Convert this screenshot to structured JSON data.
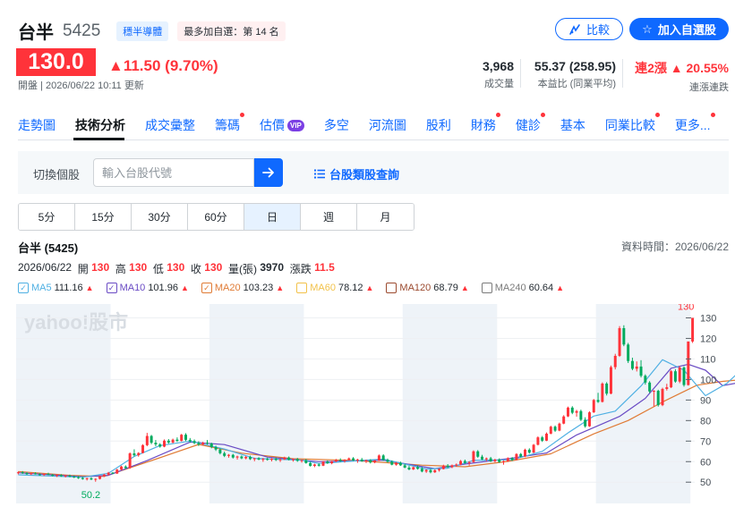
{
  "header": {
    "name": "台半",
    "code": "5425",
    "badge_sector": "穩半導體",
    "badge_rank": "最多加自選：第 14 名",
    "compare_label": "比較",
    "watchlist_label": "加入自選股"
  },
  "quote": {
    "price": "130.0",
    "change": "▲11.50 (9.70%)",
    "status_time": "開盤 | 2026/06/22 10:11 更新"
  },
  "stats": [
    {
      "value": "3,968",
      "label": "成交量"
    },
    {
      "value": "55.37 (258.95)",
      "label": "本益比 (同業平均)"
    },
    {
      "value": "連2漲 ▲ 20.55%",
      "label": "連漲連跌"
    }
  ],
  "tabs": [
    {
      "label": "走勢圖",
      "dot": false
    },
    {
      "label": "技術分析",
      "dot": false,
      "active": true
    },
    {
      "label": "成交彙整",
      "dot": false
    },
    {
      "label": "籌碼",
      "dot": true
    },
    {
      "label": "估價",
      "dot": false,
      "vip": "VIP"
    },
    {
      "label": "多空",
      "dot": false
    },
    {
      "label": "河流圖",
      "dot": false
    },
    {
      "label": "股利",
      "dot": false
    },
    {
      "label": "財務",
      "dot": true
    },
    {
      "label": "健診",
      "dot": true
    },
    {
      "label": "基本",
      "dot": false
    },
    {
      "label": "同業比較",
      "dot": true
    },
    {
      "label": "更多...",
      "dot": true
    }
  ],
  "search": {
    "label": "切換個股",
    "placeholder": "輸入台股代號",
    "category_link": "台股類股查詢"
  },
  "periods": [
    "5分",
    "15分",
    "30分",
    "60分",
    "日",
    "週",
    "月"
  ],
  "active_period": "日",
  "chart_header": {
    "title": "台半 (5425)",
    "data_time": "資料時間：2026/06/22",
    "date": "2026/06/22",
    "open_label": "開",
    "open": "130",
    "high_label": "高",
    "high": "130",
    "low_label": "低",
    "low": "130",
    "close_label": "收",
    "close": "130",
    "volume_label": "量(張)",
    "volume": "3970",
    "change_label": "漲跌",
    "change": "11.5"
  },
  "ma_legend": [
    {
      "name": "MA5",
      "value": "111.16",
      "color": "#4fb0e3"
    },
    {
      "name": "MA10",
      "value": "101.96",
      "color": "#6a4bc4"
    },
    {
      "name": "MA20",
      "value": "103.23",
      "color": "#e07b35"
    },
    {
      "name": "MA60",
      "value": "78.12",
      "color": "#f2c24a"
    },
    {
      "name": "MA120",
      "value": "68.79",
      "color": "#9b4a2f"
    },
    {
      "name": "MA240",
      "value": "60.64",
      "color": "#7a7a7a"
    }
  ],
  "colors": {
    "accent": "#0f69ff",
    "up": "#ff333a",
    "down": "#00ab5e"
  },
  "chart_data": {
    "type": "candlestick",
    "watermark": "yahoo!股市",
    "y_ticks": [
      50,
      60,
      70,
      80,
      90,
      100,
      110,
      120,
      130
    ],
    "ylim": [
      44,
      135
    ],
    "last_price_label": "130",
    "min_label": "50.2",
    "min_value": 50.2,
    "candles": [
      [
        54.5,
        55.2,
        53.8,
        54.8
      ],
      [
        54.8,
        55.4,
        54.0,
        54.4
      ],
      [
        54.4,
        54.9,
        53.6,
        53.9
      ],
      [
        53.9,
        54.6,
        53.5,
        54.3
      ],
      [
        54.3,
        54.8,
        53.7,
        53.8
      ],
      [
        53.8,
        54.3,
        53.2,
        53.5
      ],
      [
        53.5,
        54.2,
        53.0,
        54.0
      ],
      [
        54.0,
        54.6,
        53.4,
        53.6
      ],
      [
        53.6,
        54.0,
        52.8,
        53.1
      ],
      [
        53.1,
        53.8,
        52.5,
        53.4
      ],
      [
        53.4,
        53.9,
        52.6,
        52.9
      ],
      [
        52.9,
        53.5,
        52.3,
        53.2
      ],
      [
        53.2,
        53.7,
        52.4,
        52.7
      ],
      [
        52.7,
        53.3,
        52.0,
        52.4
      ],
      [
        52.4,
        53.0,
        51.6,
        52.0
      ],
      [
        52.0,
        52.6,
        51.2,
        51.5
      ],
      [
        51.5,
        52.2,
        50.8,
        51.9
      ],
      [
        51.9,
        52.4,
        51.0,
        51.3
      ],
      [
        51.3,
        51.9,
        50.2,
        51.6
      ],
      [
        51.6,
        53.2,
        51.3,
        52.9
      ],
      [
        52.9,
        54.0,
        52.5,
        53.7
      ],
      [
        53.7,
        55.0,
        53.2,
        54.6
      ],
      [
        54.6,
        54.9,
        53.9,
        54.2
      ],
      [
        54.2,
        56.5,
        54.0,
        56.1
      ],
      [
        56.1,
        58.0,
        55.8,
        57.6
      ],
      [
        57.6,
        58.2,
        56.4,
        56.9
      ],
      [
        56.9,
        64.5,
        56.5,
        64.0
      ],
      [
        64.0,
        66.0,
        62.5,
        63.1
      ],
      [
        63.1,
        64.6,
        62.4,
        64.2
      ],
      [
        64.2,
        68.5,
        64.0,
        68.0
      ],
      [
        68.0,
        74.0,
        67.5,
        72.5
      ],
      [
        72.5,
        73.0,
        68.5,
        69.2
      ],
      [
        69.2,
        70.5,
        67.5,
        68.4
      ],
      [
        68.4,
        69.0,
        66.8,
        67.3
      ],
      [
        67.3,
        70.8,
        67.0,
        70.2
      ],
      [
        70.2,
        71.0,
        68.7,
        69.3
      ],
      [
        69.3,
        71.2,
        68.9,
        70.7
      ],
      [
        70.7,
        71.8,
        69.6,
        70.1
      ],
      [
        70.1,
        73.5,
        69.8,
        73.1
      ],
      [
        73.1,
        73.8,
        70.0,
        70.6
      ],
      [
        70.6,
        71.5,
        69.2,
        70.0
      ],
      [
        70.0,
        70.8,
        68.5,
        69.1
      ],
      [
        69.1,
        69.9,
        67.6,
        68.4
      ],
      [
        68.4,
        69.7,
        67.9,
        69.2
      ],
      [
        69.2,
        70.5,
        68.3,
        68.8
      ],
      [
        68.8,
        69.2,
        66.5,
        67.1
      ],
      [
        67.1,
        67.8,
        65.2,
        65.9
      ],
      [
        65.9,
        66.5,
        63.5,
        64.1
      ],
      [
        64.1,
        64.9,
        62.2,
        62.8
      ],
      [
        62.8,
        63.7,
        61.9,
        63.3
      ],
      [
        63.3,
        63.8,
        61.5,
        62.0
      ],
      [
        62.0,
        62.9,
        61.0,
        62.5
      ],
      [
        62.5,
        63.0,
        61.2,
        61.6
      ],
      [
        61.6,
        62.8,
        61.1,
        62.3
      ],
      [
        62.3,
        62.9,
        60.8,
        61.2
      ],
      [
        61.2,
        61.9,
        60.2,
        61.6
      ],
      [
        61.6,
        62.2,
        60.7,
        61.0
      ],
      [
        61.0,
        61.8,
        59.9,
        61.3
      ],
      [
        61.3,
        61.9,
        60.5,
        60.9
      ],
      [
        60.9,
        61.7,
        60.1,
        61.4
      ],
      [
        61.4,
        62.0,
        60.3,
        60.8
      ],
      [
        60.8,
        61.5,
        59.8,
        61.1
      ],
      [
        61.1,
        62.4,
        60.8,
        62.0
      ],
      [
        62.0,
        62.5,
        60.6,
        60.9
      ],
      [
        60.9,
        61.6,
        60.0,
        61.2
      ],
      [
        61.2,
        61.8,
        59.9,
        60.4
      ],
      [
        60.4,
        61.0,
        59.5,
        60.7
      ],
      [
        60.7,
        61.3,
        59.0,
        59.3
      ],
      [
        59.3,
        59.9,
        57.6,
        57.9
      ],
      [
        57.9,
        59.0,
        57.3,
        58.6
      ],
      [
        58.6,
        59.2,
        57.6,
        58.0
      ],
      [
        58.0,
        60.3,
        57.8,
        60.0
      ],
      [
        60.0,
        60.6,
        58.9,
        59.2
      ],
      [
        59.2,
        60.4,
        58.7,
        60.1
      ],
      [
        60.1,
        61.3,
        59.8,
        60.8
      ],
      [
        60.8,
        61.6,
        59.9,
        60.3
      ],
      [
        60.3,
        61.2,
        59.5,
        60.9
      ],
      [
        60.9,
        62.0,
        60.5,
        61.6
      ],
      [
        61.6,
        62.2,
        60.3,
        60.6
      ],
      [
        60.6,
        61.4,
        59.4,
        61.0
      ],
      [
        61.0,
        61.8,
        59.9,
        60.2
      ],
      [
        60.2,
        61.0,
        59.3,
        60.7
      ],
      [
        60.7,
        61.2,
        59.1,
        59.6
      ],
      [
        59.6,
        60.8,
        59.2,
        60.5
      ],
      [
        60.5,
        63.5,
        60.3,
        63.0
      ],
      [
        63.0,
        63.6,
        60.4,
        60.8
      ],
      [
        60.8,
        61.5,
        59.5,
        59.9
      ],
      [
        59.9,
        60.6,
        58.2,
        58.5
      ],
      [
        58.5,
        59.8,
        58.0,
        59.4
      ],
      [
        59.4,
        60.0,
        57.9,
        58.2
      ],
      [
        58.2,
        58.9,
        56.8,
        57.1
      ],
      [
        57.1,
        58.0,
        55.8,
        56.2
      ],
      [
        56.2,
        57.6,
        55.9,
        57.3
      ],
      [
        57.3,
        58.2,
        56.1,
        56.5
      ],
      [
        56.5,
        57.4,
        54.8,
        55.2
      ],
      [
        55.2,
        56.3,
        54.5,
        55.9
      ],
      [
        55.9,
        56.5,
        54.3,
        54.8
      ],
      [
        54.8,
        56.2,
        54.5,
        55.8
      ],
      [
        55.8,
        56.7,
        55.1,
        56.4
      ],
      [
        56.4,
        58.5,
        56.2,
        58.0
      ],
      [
        58.0,
        58.8,
        56.9,
        57.3
      ],
      [
        57.3,
        58.6,
        56.8,
        58.2
      ],
      [
        58.2,
        59.1,
        57.5,
        58.6
      ],
      [
        58.6,
        60.8,
        58.3,
        60.3
      ],
      [
        60.3,
        61.0,
        58.9,
        59.4
      ],
      [
        59.4,
        60.2,
        58.1,
        59.8
      ],
      [
        59.8,
        65.5,
        59.5,
        65.0
      ],
      [
        65.0,
        65.6,
        61.9,
        62.4
      ],
      [
        62.4,
        63.3,
        60.7,
        61.1
      ],
      [
        61.1,
        62.0,
        60.2,
        61.6
      ],
      [
        61.6,
        62.3,
        59.8,
        60.2
      ],
      [
        60.2,
        61.4,
        59.6,
        61.0
      ],
      [
        61.0,
        61.6,
        59.4,
        59.8
      ],
      [
        59.8,
        60.6,
        58.5,
        60.2
      ],
      [
        60.2,
        62.1,
        59.9,
        61.7
      ],
      [
        61.7,
        62.2,
        60.3,
        60.8
      ],
      [
        60.8,
        64.1,
        60.6,
        63.7
      ],
      [
        63.7,
        64.2,
        62.0,
        62.5
      ],
      [
        62.5,
        66.3,
        62.2,
        65.8
      ],
      [
        65.8,
        66.5,
        63.9,
        64.4
      ],
      [
        64.4,
        68.6,
        64.1,
        68.2
      ],
      [
        68.2,
        72.3,
        67.9,
        71.8
      ],
      [
        71.8,
        72.5,
        69.6,
        70.2
      ],
      [
        70.2,
        74.2,
        70.0,
        73.6
      ],
      [
        73.6,
        77.5,
        73.3,
        77.0
      ],
      [
        77.0,
        77.6,
        74.5,
        75.1
      ],
      [
        75.1,
        79.0,
        74.8,
        78.5
      ],
      [
        78.5,
        82.6,
        78.2,
        82.0
      ],
      [
        82.0,
        86.8,
        81.7,
        86.3
      ],
      [
        86.3,
        87.0,
        83.1,
        83.8
      ],
      [
        83.8,
        85.2,
        81.9,
        84.6
      ],
      [
        84.6,
        85.3,
        79.8,
        80.4
      ],
      [
        80.4,
        81.6,
        76.5,
        77.2
      ],
      [
        77.2,
        84.5,
        76.9,
        84.0
      ],
      [
        84.0,
        90.5,
        83.7,
        90.0
      ],
      [
        90.0,
        93.5,
        88.6,
        89.1
      ],
      [
        89.1,
        98.6,
        88.8,
        98.0
      ],
      [
        98.0,
        98.7,
        92.2,
        93.1
      ],
      [
        93.1,
        106.8,
        92.8,
        106.0
      ],
      [
        106.0,
        112.5,
        104.9,
        111.5
      ],
      [
        111.5,
        126.0,
        111.0,
        125.0
      ],
      [
        125.0,
        126.4,
        116.2,
        117.0
      ],
      [
        117.0,
        117.8,
        108.0,
        109.0
      ],
      [
        109.0,
        110.6,
        104.5,
        105.2
      ],
      [
        105.2,
        108.8,
        103.9,
        106.3
      ],
      [
        106.3,
        109.4,
        101.0,
        101.8
      ],
      [
        101.8,
        102.5,
        97.5,
        98.5
      ],
      [
        98.5,
        99.2,
        93.4,
        94.2
      ],
      [
        94.2,
        94.8,
        86.8,
        94.5
      ],
      [
        94.5,
        95.0,
        86.8,
        87.5
      ],
      [
        87.5,
        96.0,
        87.0,
        95.4
      ],
      [
        95.4,
        97.9,
        94.6,
        96.2
      ],
      [
        96.2,
        104.6,
        95.8,
        104.0
      ],
      [
        104.0,
        105.0,
        98.4,
        99.0
      ],
      [
        99.0,
        106.5,
        98.2,
        105.8
      ],
      [
        105.8,
        106.4,
        96.5,
        97.3
      ],
      [
        97.3,
        118.5,
        97.0,
        118.5
      ],
      [
        118.5,
        130.0,
        117.8,
        130.0
      ]
    ],
    "ma": {
      "MA5": [
        [
          0,
          53.6
        ],
        [
          15,
          52.4
        ],
        [
          21,
          54.3
        ],
        [
          27,
          62.5
        ],
        [
          33,
          67.8
        ],
        [
          40,
          70.0
        ],
        [
          48,
          66.1
        ],
        [
          55,
          61.6
        ],
        [
          66,
          60.7
        ],
        [
          70,
          59.1
        ],
        [
          80,
          60.6
        ],
        [
          85,
          61.2
        ],
        [
          95,
          56.4
        ],
        [
          100,
          56.8
        ],
        [
          106,
          60.6
        ],
        [
          115,
          60.9
        ],
        [
          122,
          65.0
        ],
        [
          128,
          74.0
        ],
        [
          134,
          82.2
        ],
        [
          139,
          84.6
        ],
        [
          145,
          96.8
        ],
        [
          150,
          109.6
        ],
        [
          155,
          104.5
        ],
        [
          160,
          92.1
        ],
        [
          165,
          98.1
        ],
        [
          171,
          110.0
        ],
        [
          174,
          116.6
        ]
      ],
      "MA10": [
        [
          0,
          54.6
        ],
        [
          15,
          52.6
        ],
        [
          21,
          53.3
        ],
        [
          30,
          60.5
        ],
        [
          40,
          69.5
        ],
        [
          48,
          68.3
        ],
        [
          58,
          62.2
        ],
        [
          70,
          60.0
        ],
        [
          85,
          60.7
        ],
        [
          97,
          56.6
        ],
        [
          104,
          58.8
        ],
        [
          115,
          61.7
        ],
        [
          123,
          64.2
        ],
        [
          130,
          73.0
        ],
        [
          140,
          82.0
        ],
        [
          146,
          90.8
        ],
        [
          152,
          105.5
        ],
        [
          156,
          107.4
        ],
        [
          160,
          104.5
        ],
        [
          164,
          97.0
        ],
        [
          168,
          98.5
        ],
        [
          174,
          104.3
        ]
      ],
      "MA20": [
        [
          0,
          55.2
        ],
        [
          12,
          53.3
        ],
        [
          20,
          52.8
        ],
        [
          32,
          61.2
        ],
        [
          42,
          68.4
        ],
        [
          52,
          64.1
        ],
        [
          64,
          61.4
        ],
        [
          78,
          60.6
        ],
        [
          94,
          58.3
        ],
        [
          104,
          57.5
        ],
        [
          114,
          60.1
        ],
        [
          124,
          63.8
        ],
        [
          134,
          73.5
        ],
        [
          142,
          80.0
        ],
        [
          150,
          89.0
        ],
        [
          158,
          97.2
        ],
        [
          164,
          99.1
        ],
        [
          170,
          100.2
        ],
        [
          174,
          103.5
        ]
      ],
      "MA60": [
        [
          0,
          57.0
        ],
        [
          20,
          55.2
        ],
        [
          40,
          62.5
        ],
        [
          60,
          63.8
        ],
        [
          80,
          61.5
        ],
        [
          100,
          59.6
        ],
        [
          120,
          60.9
        ],
        [
          135,
          66.5
        ],
        [
          150,
          73.0
        ],
        [
          162,
          76.6
        ],
        [
          174,
          78.4
        ]
      ],
      "MA120": [
        [
          0,
          58.6
        ],
        [
          30,
          57.5
        ],
        [
          60,
          60.2
        ],
        [
          90,
          60.0
        ],
        [
          120,
          60.4
        ],
        [
          140,
          63.0
        ],
        [
          160,
          67.2
        ],
        [
          174,
          69.0
        ]
      ]
    }
  }
}
